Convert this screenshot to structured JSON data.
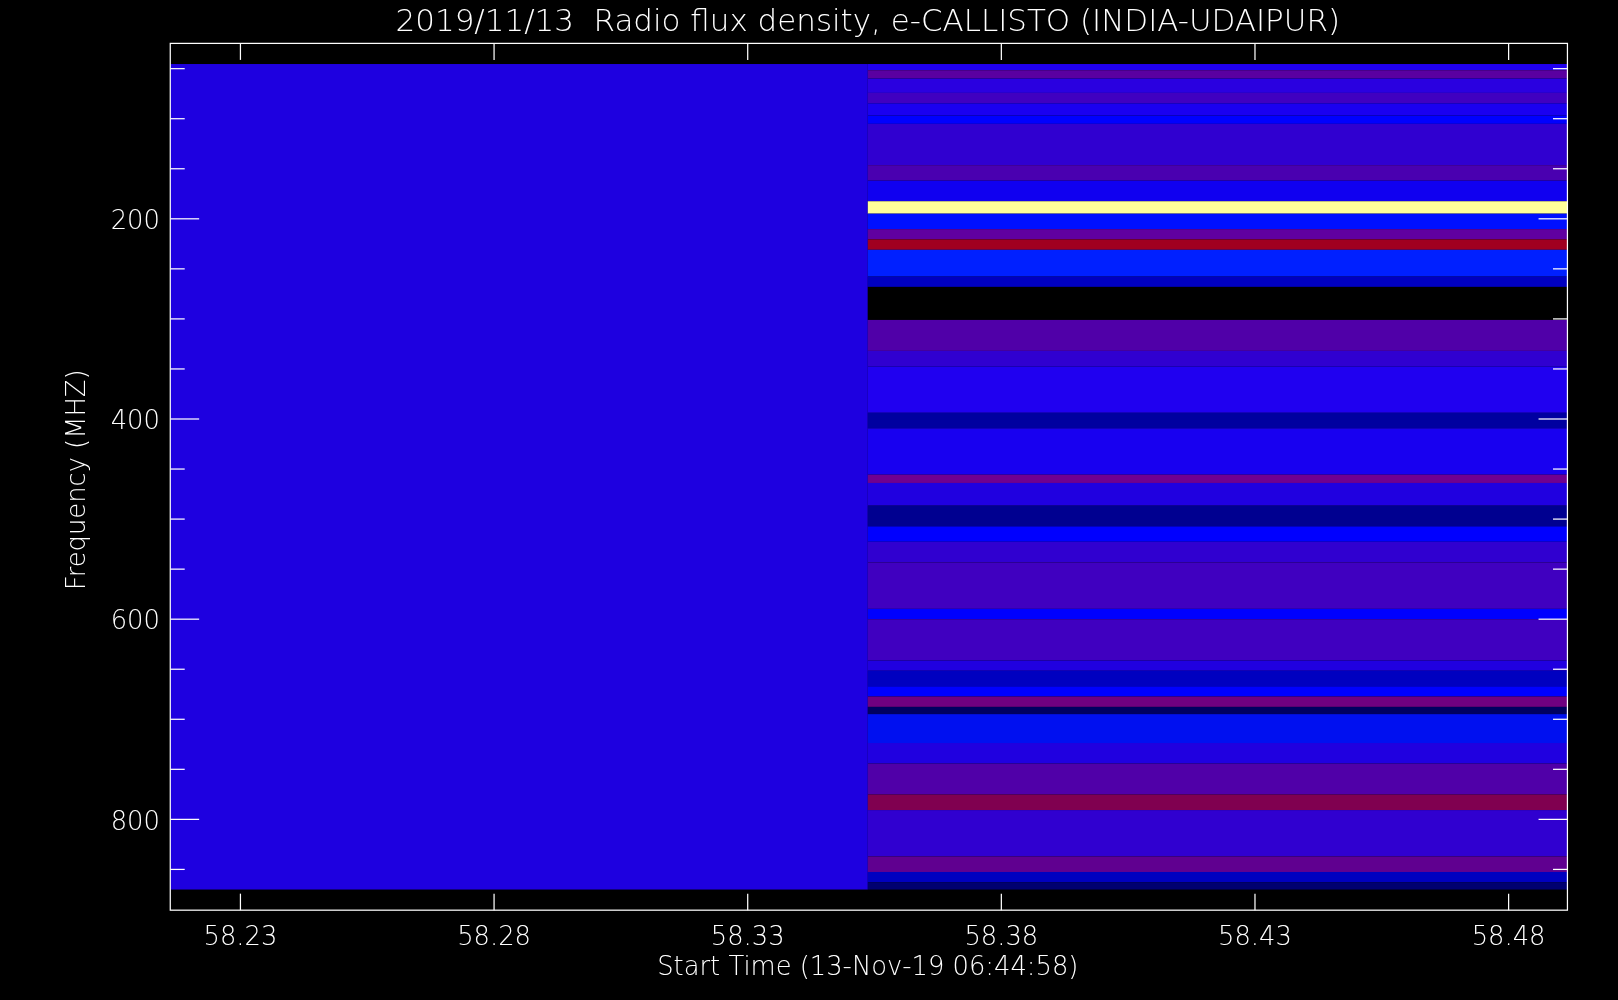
{
  "title": "2019/11/13  Radio flux density, e-CALLISTO (INDIA-UDAIPUR)",
  "ylabel": "Frequency (MHZ)",
  "xlabel": "Start Time (13-Nov-19 06:44:58)",
  "yticks": [
    "200",
    "400",
    "600",
    "800"
  ],
  "xticks": [
    "58.23",
    "58.28",
    "58.33",
    "58.38",
    "58.43",
    "58.48"
  ]
}
